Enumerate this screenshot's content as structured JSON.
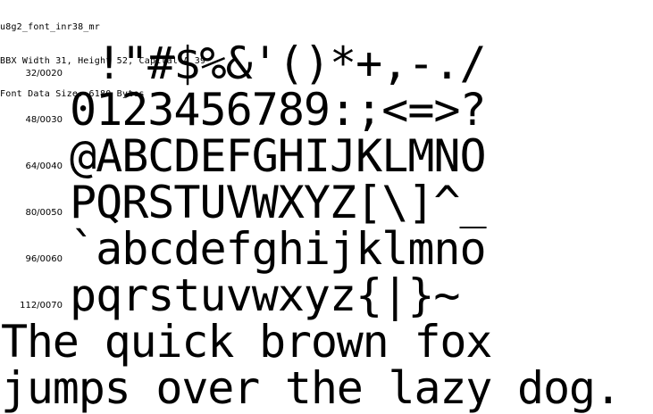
{
  "header": {
    "font_name": "u8g2_font_inr38_mr",
    "bbx_info": "BBX Width 31, Height 52, Capital A 39",
    "data_size": "Font Data Size: 6180 Bytes"
  },
  "rows": [
    {
      "code": "32/0020",
      "glyphs": " !\"#$%&'()*+,-./"
    },
    {
      "code": "48/0030",
      "glyphs": "0123456789:;<=>?"
    },
    {
      "code": "64/0040",
      "glyphs": "@ABCDEFGHIJKLMNO"
    },
    {
      "code": "80/0050",
      "glyphs": "PQRSTUVWXYZ[\\]^_"
    },
    {
      "code": "96/0060",
      "glyphs": "`abcdefghijklmno"
    },
    {
      "code": "112/0070",
      "glyphs": "pqrstuvwxyz{|}~"
    }
  ],
  "pangram": {
    "line1": "The quick brown fox",
    "line2": "jumps over the lazy dog."
  }
}
